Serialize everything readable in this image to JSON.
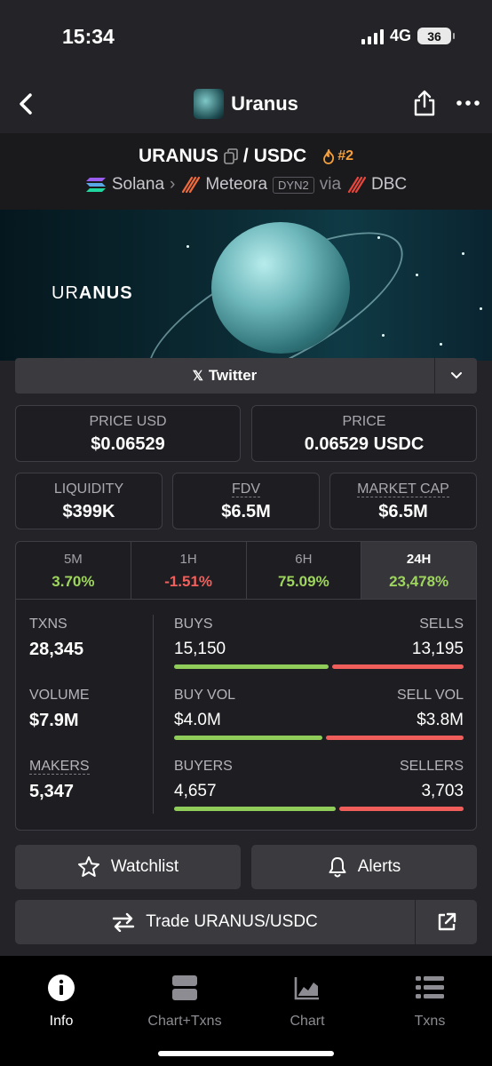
{
  "status_bar": {
    "time": "15:34",
    "network": "4G",
    "battery": "36"
  },
  "nav": {
    "title": "Uranus"
  },
  "pair": {
    "base": "URANUS",
    "separator": "/",
    "quote": "USDC",
    "rank": "#2",
    "chain": "Solana",
    "dex": "Meteora",
    "dex_tag": "DYN2",
    "via": "via",
    "launchpad": "DBC"
  },
  "banner": {
    "text_light": "UR",
    "text_bold": "ANUS"
  },
  "socials": {
    "twitter_label": "Twitter"
  },
  "prices": {
    "price_usd_label": "PRICE USD",
    "price_usd": "$0.06529",
    "price_label": "PRICE",
    "price": "0.06529 USDC"
  },
  "metrics": {
    "liquidity_label": "LIQUIDITY",
    "liquidity": "$399K",
    "fdv_label": "FDV",
    "fdv": "$6.5M",
    "mcap_label": "MARKET CAP",
    "mcap": "$6.5M"
  },
  "timeframes": [
    {
      "label": "5M",
      "change": "3.70%",
      "status": "up"
    },
    {
      "label": "1H",
      "change": "-1.51%",
      "status": "down"
    },
    {
      "label": "6H",
      "change": "75.09%",
      "status": "up"
    },
    {
      "label": "24H",
      "change": "23,478%",
      "status": "up",
      "active": true
    }
  ],
  "stats": {
    "txns_label": "TXNS",
    "txns": "28,345",
    "volume_label": "VOLUME",
    "volume": "$7.9M",
    "makers_label": "MAKERS",
    "makers": "5,347",
    "buys_label": "BUYS",
    "buys": "15,150",
    "sells_label": "SELLS",
    "sells": "13,195",
    "buys_share": 0.534,
    "buyvol_label": "BUY VOL",
    "buyvol": "$4.0M",
    "sellvol_label": "SELL VOL",
    "sellvol": "$3.8M",
    "buyvol_share": 0.513,
    "buyers_label": "BUYERS",
    "buyers": "4,657",
    "sellers_label": "SELLERS",
    "sellers": "3,703",
    "buyers_share": 0.557
  },
  "actions": {
    "watchlist": "Watchlist",
    "alerts": "Alerts",
    "trade": "Trade URANUS/USDC"
  },
  "tabbar": {
    "info": "Info",
    "chart_txns": "Chart+Txns",
    "chart": "Chart",
    "txns": "Txns"
  },
  "colors": {
    "positive": "#9ed55d",
    "negative": "#f0605c",
    "rank": "#f6a03c"
  }
}
